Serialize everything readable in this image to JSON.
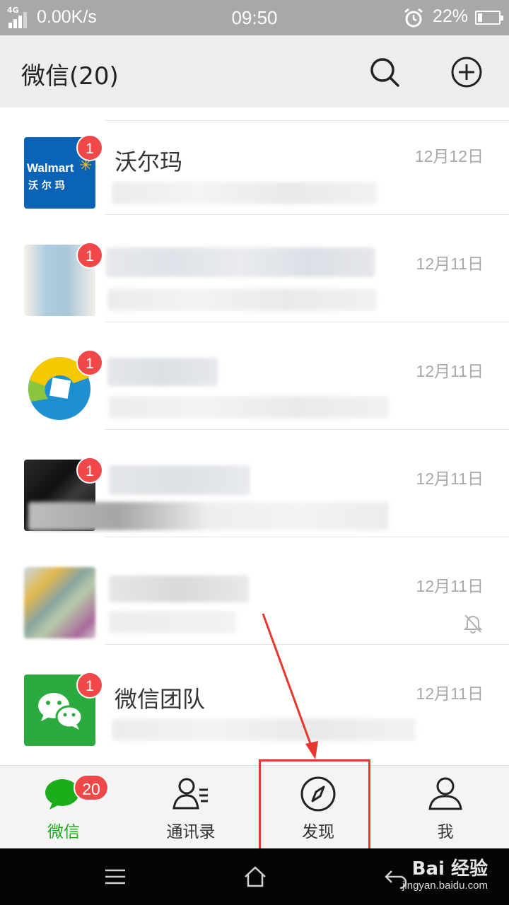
{
  "status_bar": {
    "network": "4G",
    "speed": "0.00K/s",
    "time": "09:50",
    "battery_percent": "22%",
    "battery_level": 0.22,
    "alarm_icon": "alarm-clock-icon"
  },
  "header": {
    "title": "微信(20)",
    "search_icon": "search-icon",
    "add_icon": "plus-circle-icon"
  },
  "chats": [
    {
      "name": "沃尔玛",
      "date": "12月12日",
      "badge": "1",
      "avatar_text_1": "Walmart",
      "avatar_text_2": "沃 尔 玛"
    },
    {
      "name": "",
      "date": "12月11日",
      "badge": "1"
    },
    {
      "name": "",
      "date": "12月11日",
      "badge": "1"
    },
    {
      "name": "",
      "date": "12月11日",
      "badge": "1"
    },
    {
      "name": "",
      "date": "12月11日",
      "badge": "",
      "muted": true
    },
    {
      "name": "微信团队",
      "date": "12月11日",
      "badge": "1"
    }
  ],
  "tabs": [
    {
      "label": "微信",
      "badge": "20",
      "icon": "chat-bubble-icon",
      "active": true
    },
    {
      "label": "通讯录",
      "icon": "contacts-icon"
    },
    {
      "label": "发现",
      "icon": "compass-icon"
    },
    {
      "label": "我",
      "icon": "person-icon"
    }
  ],
  "colors": {
    "accent_green": "#1aad19",
    "badge_red": "#f04848",
    "annotation_red": "#e8372e"
  },
  "watermark": {
    "brand": "Bai  经验",
    "url": "jingyan.baidu.com"
  }
}
